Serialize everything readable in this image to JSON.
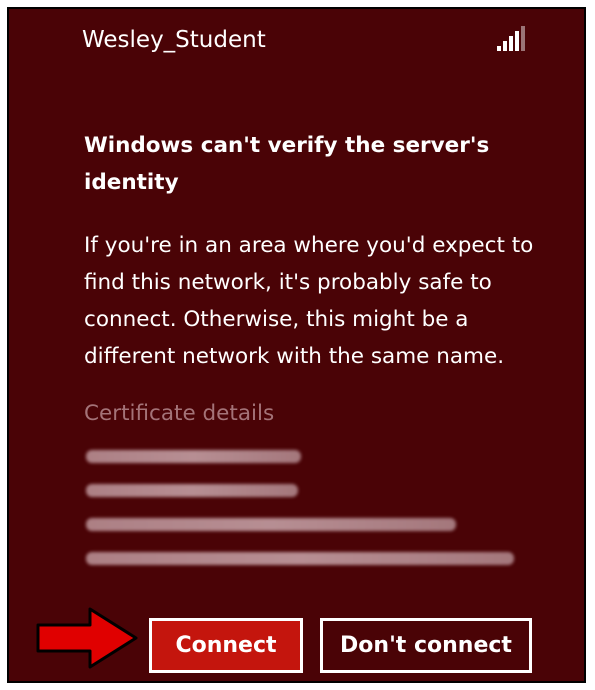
{
  "network": {
    "name": "Wesley_Student",
    "signal_icon": "wifi-signal-icon"
  },
  "dialog": {
    "heading": "Windows can't verify the server's identity",
    "body": "If you're in an area where you'd expect to find this network, it's probably safe to connect. Otherwise, this might be a different network with the same name.",
    "certificate_title": "Certificate details"
  },
  "buttons": {
    "connect_label": "Connect",
    "dont_connect_label": "Don't connect"
  },
  "colors": {
    "background": "#4a0306",
    "accent": "#c4150d",
    "arrow": "#e00000",
    "muted_text": "#a47378"
  }
}
